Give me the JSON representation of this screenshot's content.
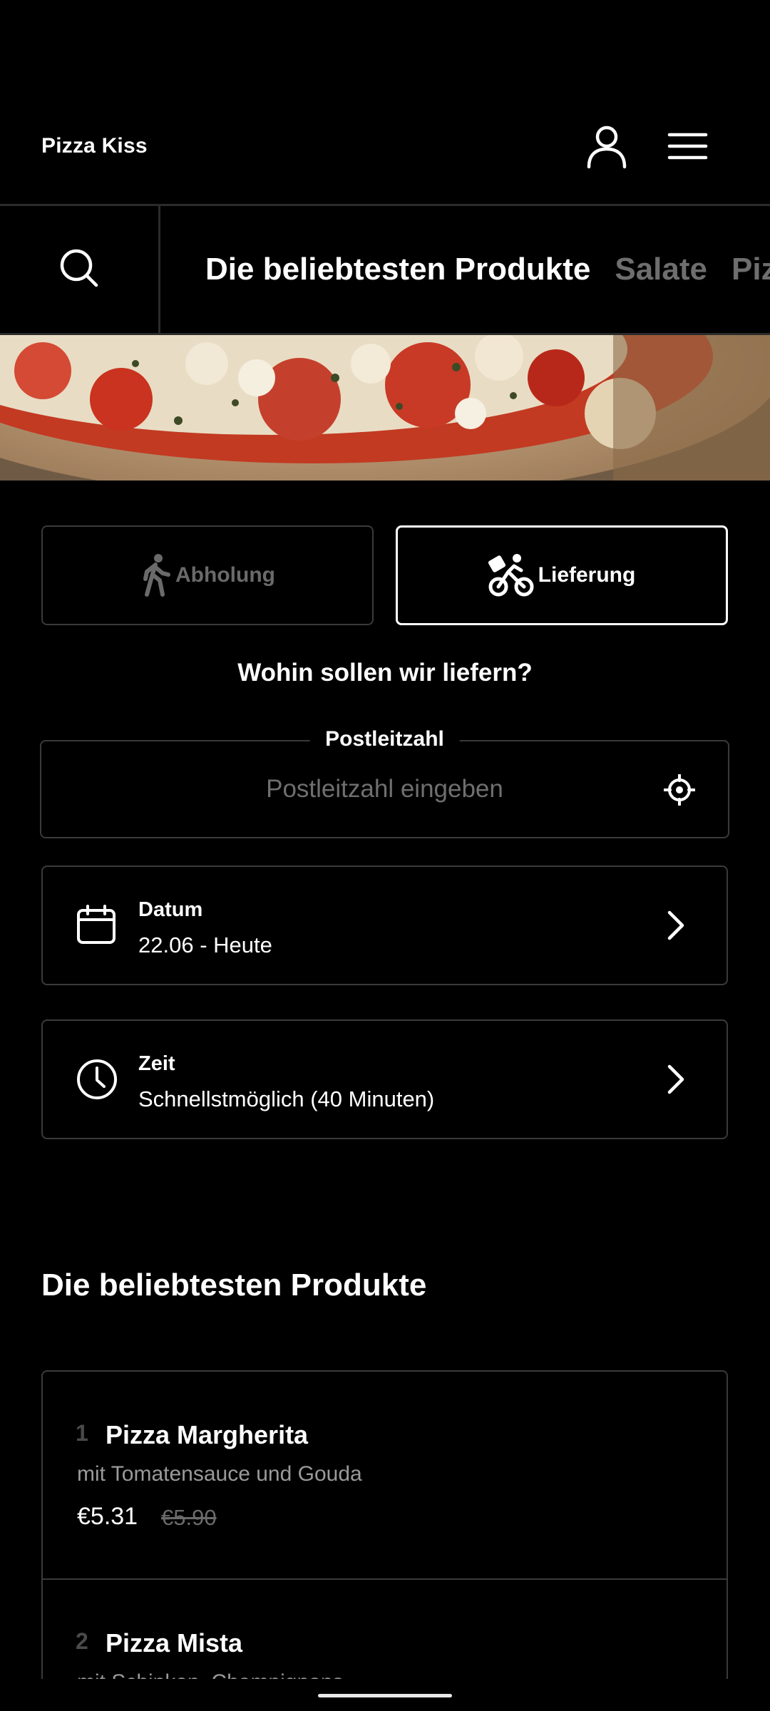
{
  "header": {
    "brand": "Pizza Kiss",
    "account_icon": "user-icon",
    "menu_icon": "hamburger-menu-icon"
  },
  "nav": {
    "search_icon": "search-icon",
    "tabs": [
      {
        "label": "Die beliebtesten Produkte",
        "active": true
      },
      {
        "label": "Salate",
        "active": false
      },
      {
        "label": "Pizza",
        "active": false
      }
    ]
  },
  "hero": {
    "description": "pizza-photo"
  },
  "order_mode": {
    "pickup_label": "Abholung",
    "pickup_icon": "walking-person-icon",
    "delivery_label": "Lieferung",
    "delivery_icon": "bicycle-delivery-icon",
    "selected": "delivery"
  },
  "delivery": {
    "question": "Wohin sollen wir liefern?",
    "postal_label": "Postleitzahl",
    "postal_placeholder": "Postleitzahl eingeben",
    "postal_value": "",
    "locate_icon": "crosshair-location-icon"
  },
  "date_picker": {
    "title": "Datum",
    "value": "22.06 - Heute",
    "icon": "calendar-icon"
  },
  "time_picker": {
    "title": "Zeit",
    "value": "Schnellstmöglich (40 Minuten)",
    "icon": "clock-icon"
  },
  "section": {
    "title": "Die beliebtesten Produkte"
  },
  "products": [
    {
      "rank": "1",
      "name": "Pizza Margherita",
      "description": "mit Tomatensauce und Gouda",
      "price": "€5.31",
      "old_price": "€5.90"
    },
    {
      "rank": "2",
      "name": "Pizza Mista",
      "description": "mit Schinken, Champignons",
      "price": "",
      "old_price": ""
    }
  ],
  "colors": {
    "background": "#000000",
    "text": "#ffffff",
    "muted": "#6e6e6e",
    "border": "#3a3a3a"
  }
}
